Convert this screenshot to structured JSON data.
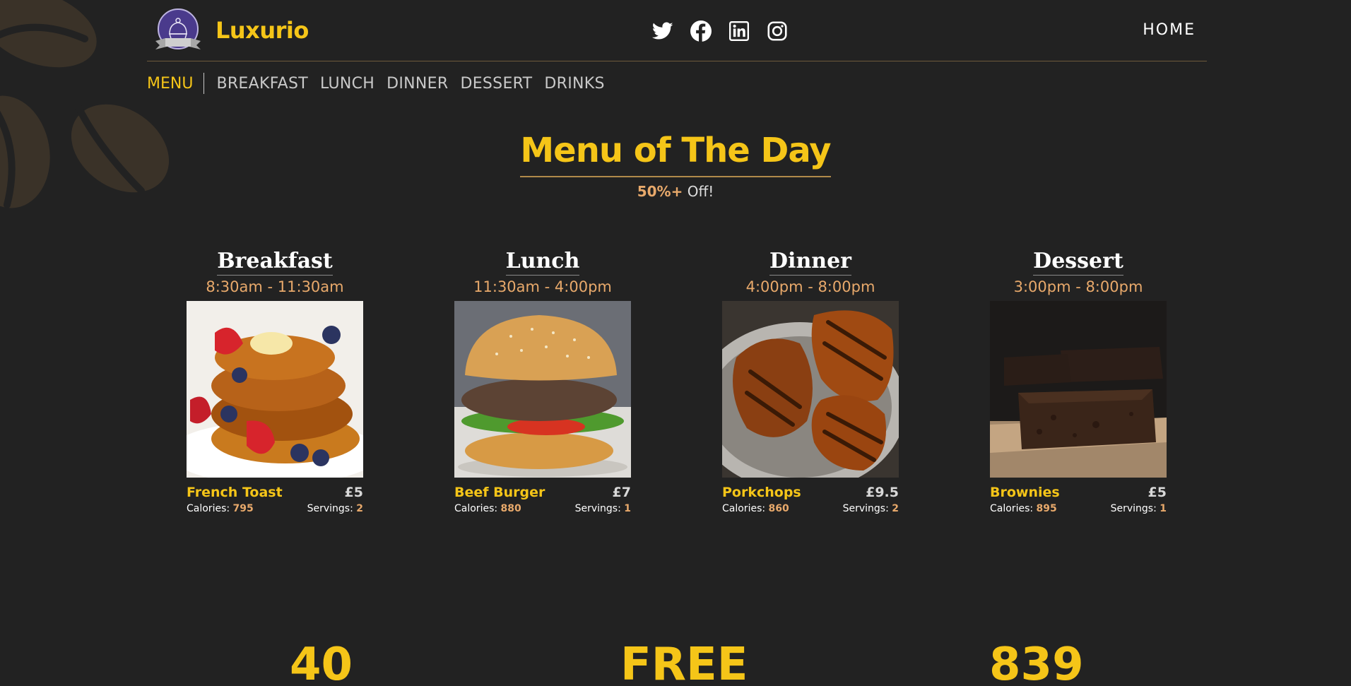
{
  "header": {
    "brand": "Luxurio",
    "home_label": "HOME",
    "socials": [
      "twitter-icon",
      "facebook-icon",
      "linkedin-icon",
      "instagram-icon"
    ]
  },
  "nav": {
    "menu_label": "MENU",
    "items": [
      "BREAKFAST",
      "LUNCH",
      "DINNER",
      "DESSERT",
      "DRINKS"
    ]
  },
  "hero": {
    "title": "Menu of The Day",
    "discount": "50%+",
    "discount_suffix": "Off!"
  },
  "cards": [
    {
      "category": "Breakfast",
      "time": "8:30am - 11:30am",
      "dish": "French Toast",
      "price": "£5",
      "calories_label": "Calories:",
      "calories": "795",
      "servings_label": "Servings:",
      "servings": "2"
    },
    {
      "category": "Lunch",
      "time": "11:30am - 4:00pm",
      "dish": "Beef Burger",
      "price": "£7",
      "calories_label": "Calories:",
      "calories": "880",
      "servings_label": "Servings:",
      "servings": "1"
    },
    {
      "category": "Dinner",
      "time": "4:00pm - 8:00pm",
      "dish": "Porkchops",
      "price": "£9.5",
      "calories_label": "Calories:",
      "calories": "860",
      "servings_label": "Servings:",
      "servings": "2"
    },
    {
      "category": "Dessert",
      "time": "3:00pm - 8:00pm",
      "dish": "Brownies",
      "price": "£5",
      "calories_label": "Calories:",
      "calories": "895",
      "servings_label": "Servings:",
      "servings": "1"
    }
  ],
  "stats": [
    "40",
    "FREE",
    "839"
  ],
  "colors": {
    "accent": "#f5c518",
    "secondary": "#e8a96b",
    "background": "#222222"
  }
}
